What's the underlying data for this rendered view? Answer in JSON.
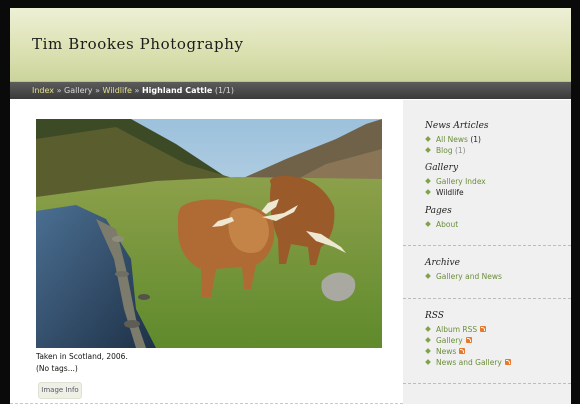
{
  "header": {
    "site_title": "Tim Brookes Photography"
  },
  "breadcrumb": {
    "index": "Index",
    "sep": "»",
    "gallery": "Gallery",
    "wildlife": "Wildlife",
    "current": "Highland Cattle",
    "counter": "(1/1)"
  },
  "main": {
    "caption": "Taken in Scotland, 2006.",
    "tags": "(No tags...)",
    "image_info_button": "Image Info"
  },
  "sidebar": {
    "news_articles": {
      "heading": "News Articles",
      "items": [
        {
          "label": "All News",
          "count": "(1)"
        },
        {
          "label": "Blog",
          "count": "(1)"
        }
      ]
    },
    "gallery": {
      "heading": "Gallery",
      "items": [
        {
          "label": "Gallery Index"
        },
        {
          "label": "Wildlife"
        }
      ]
    },
    "pages": {
      "heading": "Pages",
      "items": [
        {
          "label": "About"
        }
      ]
    },
    "archive": {
      "heading": "Archive",
      "items": [
        {
          "label": "Gallery and News"
        }
      ]
    },
    "rss": {
      "heading": "RSS",
      "items": [
        {
          "label": "Album RSS",
          "icon": "rss-icon"
        },
        {
          "label": "Gallery",
          "icon": "rss-icon"
        },
        {
          "label": "News",
          "icon": "rss-icon"
        },
        {
          "label": "News and Gallery",
          "icon": "rss-icon"
        }
      ]
    }
  },
  "colors": {
    "link": "#6b8e3a",
    "breadcrumb_link": "#e6e08a",
    "header_gradient_top": "#eef0d6",
    "header_gradient_bottom": "#ccd49c",
    "rss": "#e8782a"
  }
}
